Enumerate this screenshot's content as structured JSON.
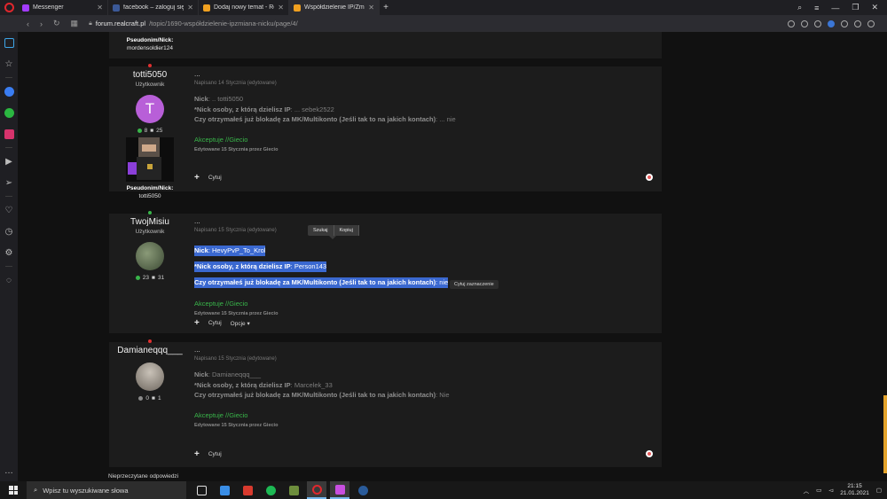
{
  "tabs": [
    {
      "title": "Messenger",
      "icon": "messenger-icon",
      "color": "#a33bff",
      "active": false
    },
    {
      "title": "facebook – zaloguj się lub",
      "icon": "facebook-icon",
      "color": "#3b5998",
      "active": false
    },
    {
      "title": "Dodaj nowy temat - RealCr",
      "icon": "realcraft-icon",
      "color": "#f0a020",
      "active": false
    },
    {
      "title": "Współdzielenie IP/Zmiana",
      "icon": "realcraft-icon",
      "color": "#f0a020",
      "active": true
    }
  ],
  "address": {
    "host": "forum.realcraft.pl",
    "path": "/topic/1690-współdzielenie-ipzmiana-nicku/page/4/"
  },
  "top_fragment": {
    "pseudo_label": "Pseudonim/Nick:",
    "pseudo_value": "mordensoldier124"
  },
  "posts": [
    {
      "username": "totti5050",
      "role": "Użytkownik",
      "avatar_letter": "T",
      "avatar_color": "#b85fd8",
      "online_color": "#e03030",
      "stats_rep": "8",
      "stats_posts": "25",
      "pseudo_label": "Pseudonim/Nick:",
      "pseudo_value": "totti5050",
      "ellipsis": "...",
      "meta": "Napisano 14 Stycznia (edytowane)",
      "lines": [
        {
          "label": "Nick",
          "value": ": .. totti5050"
        },
        {
          "label": "*Nick osoby, z którą dzielisz IP",
          "value": ": ... sebek2522"
        },
        {
          "label": "Czy otrzymałeś już blokadę za MK/Multikonto (Jeśli tak to na jakich kontach)",
          "value": ": ... nie"
        }
      ],
      "accept": "Akceptuje //Giecio",
      "edited": "Edytowane 15 Stycznia przez Giecio",
      "quote": "Cytuj"
    },
    {
      "username": "TwojMisiu",
      "role": "Użytkownik",
      "avatar_color": "#5a6b4a",
      "online_color": "#39b54a",
      "stats_rep": "23",
      "stats_posts": "31",
      "ellipsis": "...",
      "meta": "Napisano 15 Stycznia (edytowane)",
      "lines": [
        {
          "label": "Nick",
          "value": ": HevyPvP_To_Krol"
        },
        {
          "label": "*Nick osoby, z którą dzielisz IP",
          "value": ": Person143"
        },
        {
          "label": "Czy otrzymałeś już blokadę za MK/Multikonto (Jeśli tak to na jakich kontach)",
          "value": ": nie"
        }
      ],
      "accept": "Akceptuje //Giecio",
      "edited": "Edytowane 15 Stycznia przez Giecio",
      "quote": "Cytuj",
      "options": "Opcje ▾",
      "popup": {
        "search": "Szukaj",
        "copy": "Kopiuj"
      },
      "tooltip": "Cytuj zaznaczenie"
    },
    {
      "username": "Damianeqqq___",
      "role": "",
      "avatar_color": "#9a948c",
      "online_color": "#e03030",
      "stats_rep": "0",
      "stats_posts": "1",
      "ellipsis": "...",
      "meta": "Napisano 15 Stycznia (edytowane)",
      "lines": [
        {
          "label": "Nick",
          "value": ": Damianeqqq___"
        },
        {
          "label": "*Nick osoby, z którą dzielisz IP",
          "value": ": Marcelek_33"
        },
        {
          "label": "Czy otrzymałeś już blokadę za MK/Multikonto (Jeśli tak to na jakich kontach)",
          "value": ": Nie"
        }
      ],
      "accept": "Akceptuje //Giecio",
      "edited": "Edytowane 15 Stycznia przez Giecio",
      "quote": "Cytuj"
    }
  ],
  "footnote": "Nieprzeczytane odpowiedzi",
  "taskbar": {
    "search_placeholder": "Wpisz tu wyszukiwane słowa",
    "time": "21:15",
    "date": "21.01.2021"
  }
}
